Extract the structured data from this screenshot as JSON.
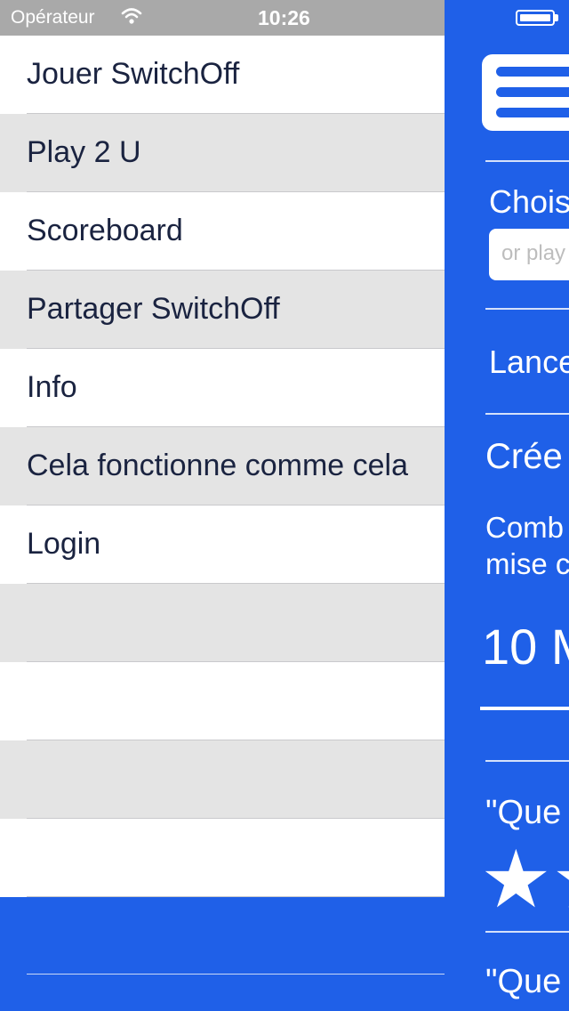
{
  "status_bar": {
    "carrier": "Opérateur",
    "time": "10:26"
  },
  "menu": {
    "items": [
      {
        "label": "Jouer SwitchOff"
      },
      {
        "label": "Play 2 U"
      },
      {
        "label": "Scoreboard"
      },
      {
        "label": "Partager SwitchOff"
      },
      {
        "label": "Info"
      },
      {
        "label": "Cela fonctionne comme cela"
      },
      {
        "label": "Login"
      }
    ]
  },
  "panel": {
    "choose_label": "Chois",
    "search_placeholder": "or play",
    "launch_label": "Lance",
    "create_label": "Crée",
    "description_line1": "Comb",
    "description_line2": "mise c",
    "amount": "10 M",
    "quote1": "\"Que",
    "quote2": "\"Que",
    "stars": "★★"
  },
  "colors": {
    "accent": "#1f60e8",
    "menu_white": "#ffffff",
    "menu_gray": "#e4e4e4",
    "menu_text": "#1a2340",
    "status_bar_bg": "#a9a9a9"
  }
}
